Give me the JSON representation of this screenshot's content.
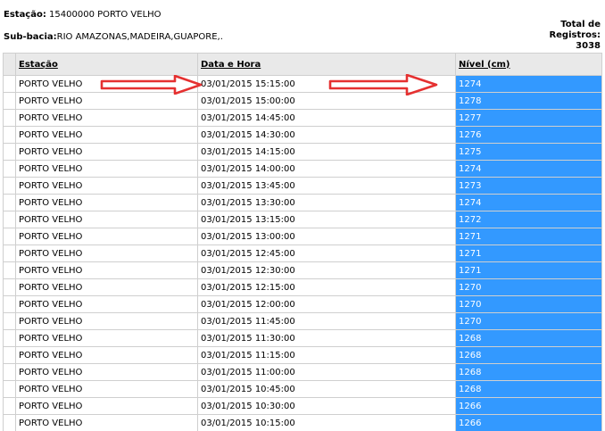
{
  "header": {
    "station_label": "Estação:",
    "station_value": "15400000 PORTO VELHO",
    "subbasin_label": "Sub-bacia:",
    "subbasin_value": "RIO AMAZONAS,MADEIRA,GUAPORE,.",
    "total_label_line1": "Total de",
    "total_label_line2": "Registros:",
    "total_value": "3038"
  },
  "table": {
    "columns": [
      "",
      "Estação",
      "Data e Hora",
      "Nível (cm)"
    ],
    "rows": [
      {
        "station": "PORTO VELHO",
        "datetime": "03/01/2015 15:15:00",
        "level": "1274"
      },
      {
        "station": "PORTO VELHO",
        "datetime": "03/01/2015 15:00:00",
        "level": "1278"
      },
      {
        "station": "PORTO VELHO",
        "datetime": "03/01/2015 14:45:00",
        "level": "1277"
      },
      {
        "station": "PORTO VELHO",
        "datetime": "03/01/2015 14:30:00",
        "level": "1276"
      },
      {
        "station": "PORTO VELHO",
        "datetime": "03/01/2015 14:15:00",
        "level": "1275"
      },
      {
        "station": "PORTO VELHO",
        "datetime": "03/01/2015 14:00:00",
        "level": "1274"
      },
      {
        "station": "PORTO VELHO",
        "datetime": "03/01/2015 13:45:00",
        "level": "1273"
      },
      {
        "station": "PORTO VELHO",
        "datetime": "03/01/2015 13:30:00",
        "level": "1274"
      },
      {
        "station": "PORTO VELHO",
        "datetime": "03/01/2015 13:15:00",
        "level": "1272"
      },
      {
        "station": "PORTO VELHO",
        "datetime": "03/01/2015 13:00:00",
        "level": "1271"
      },
      {
        "station": "PORTO VELHO",
        "datetime": "03/01/2015 12:45:00",
        "level": "1271"
      },
      {
        "station": "PORTO VELHO",
        "datetime": "03/01/2015 12:30:00",
        "level": "1271"
      },
      {
        "station": "PORTO VELHO",
        "datetime": "03/01/2015 12:15:00",
        "level": "1270"
      },
      {
        "station": "PORTO VELHO",
        "datetime": "03/01/2015 12:00:00",
        "level": "1270"
      },
      {
        "station": "PORTO VELHO",
        "datetime": "03/01/2015 11:45:00",
        "level": "1270"
      },
      {
        "station": "PORTO VELHO",
        "datetime": "03/01/2015 11:30:00",
        "level": "1268"
      },
      {
        "station": "PORTO VELHO",
        "datetime": "03/01/2015 11:15:00",
        "level": "1268"
      },
      {
        "station": "PORTO VELHO",
        "datetime": "03/01/2015 11:00:00",
        "level": "1268"
      },
      {
        "station": "PORTO VELHO",
        "datetime": "03/01/2015 10:45:00",
        "level": "1268"
      },
      {
        "station": "PORTO VELHO",
        "datetime": "03/01/2015 10:30:00",
        "level": "1266"
      },
      {
        "station": "PORTO VELHO",
        "datetime": "03/01/2015 10:15:00",
        "level": "1266"
      }
    ]
  },
  "colors": {
    "level_highlight": "#3399ff",
    "arrow": "#e53030",
    "header_bg": "#e9e9e9"
  },
  "annotations": [
    "red-arrow-icon",
    "red-arrow-icon"
  ]
}
